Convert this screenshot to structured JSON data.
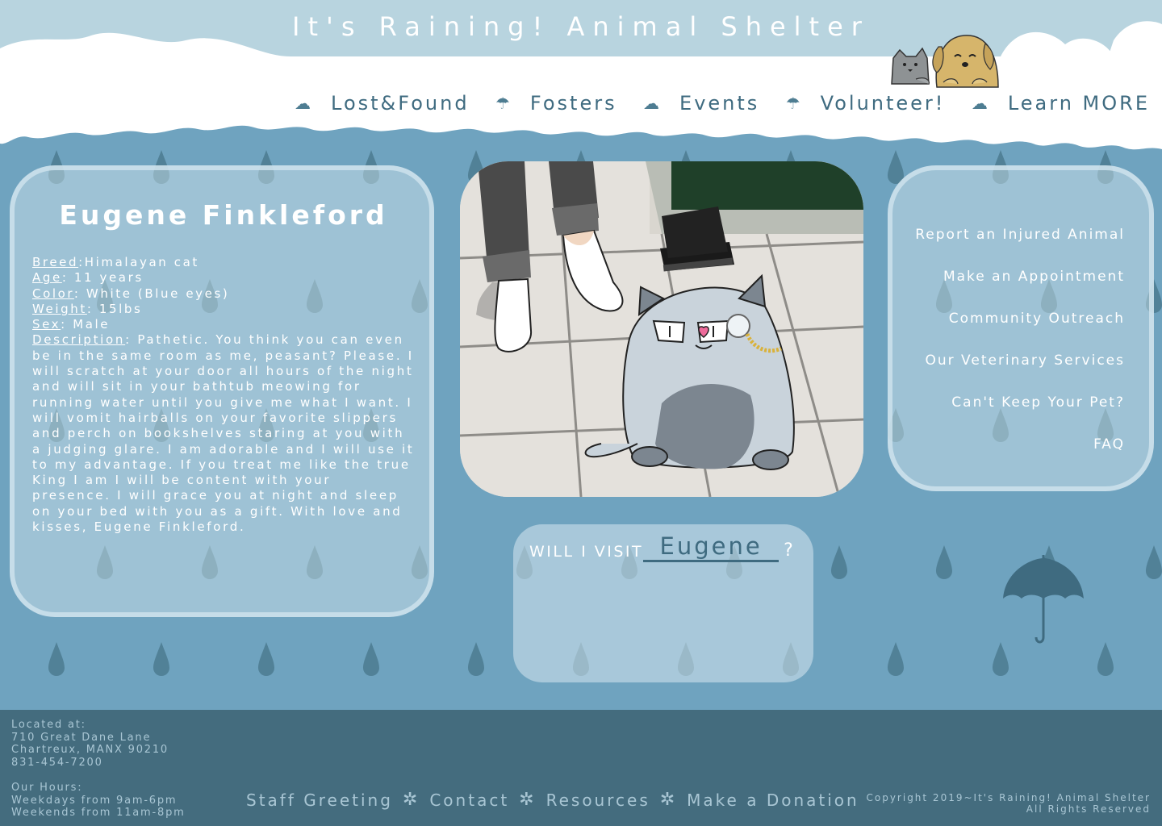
{
  "site": {
    "title": "It's Raining! Animal Shelter"
  },
  "nav": {
    "items": [
      {
        "label": "Lost&Found",
        "icon": "cloud-icon"
      },
      {
        "label": "Fosters",
        "icon": "umbrella-icon"
      },
      {
        "label": "Events",
        "icon": "cloud-icon"
      },
      {
        "label": "Volunteer!",
        "icon": "umbrella-icon"
      },
      {
        "label": "Learn MORE",
        "icon": "cloud-icon"
      }
    ]
  },
  "profile": {
    "name": "Eugene Finkleford",
    "breed_key": "Breed",
    "breed": ":Himalayan cat",
    "age_key": "Age",
    "age": ": 11 years",
    "color_key": "Color",
    "color": ": White (Blue eyes)",
    "weight_key": "Weight",
    "weight": ": 15lbs",
    "sex_key": "Sex",
    "sex": ": Male",
    "description_key": "Description",
    "description": ": Pathetic. You think you can even be in the same room as me, peasant? Please. I will scratch at your door all hours of the night and will sit in your bathtub meowing for running water until you give me what I want. I will vomit hairballs on your favorite slippers and perch on bookshelves staring at you with a judging glare. I am adorable and I will use it to my advantage. If you treat me like the true King I am I will be content with your presence. I will grace you at night and sleep on your bed with you as a gift. With love and kisses, Eugene Finkleford."
  },
  "visit": {
    "label": "WILL I VISIT",
    "name": "Eugene",
    "question_mark": "?"
  },
  "side_links": [
    "Report an Injured Animal",
    "Make an Appointment",
    "Community Outreach",
    "Our Veterinary Services",
    "Can't Keep Your Pet?",
    "FAQ"
  ],
  "footer": {
    "located_label": "Located at:",
    "address_line1": "710 Great Dane Lane",
    "address_line2": "Chartreux, MANX 90210",
    "phone": "831-454-7200",
    "hours_label": "Our Hours:",
    "weekdays": "Weekdays from 9am-6pm",
    "weekends": "Weekends from 11am-8pm",
    "links": [
      "Staff Greeting",
      "Contact",
      "Resources",
      "Make a Donation"
    ],
    "copyright_line1": "Copyright 2019~It's Raining! Animal Shelter",
    "copyright_line2": "All Rights Reserved"
  },
  "colors": {
    "background": "#6fa3bf",
    "raindrop": "#4e7d92",
    "footer": "#446c7e",
    "nav_text": "#3f6b80",
    "sky": "#b8d4df"
  }
}
